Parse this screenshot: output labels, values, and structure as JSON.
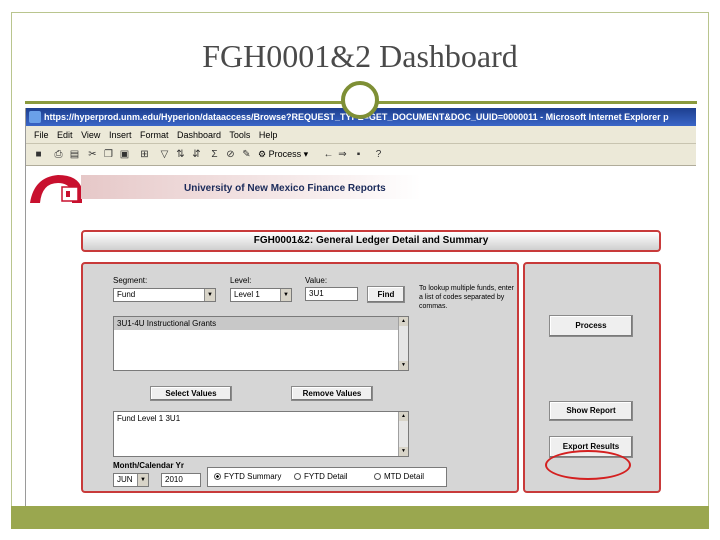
{
  "slide": {
    "title": "FGH0001&2 Dashboard"
  },
  "browser": {
    "title_bar": "https://hyperprod.unm.edu/Hyperion/dataaccess/Browse?REQUEST_TYPE=GET_DOCUMENT&DOC_UUID=0000011 - Microsoft Internet Explorer p",
    "menu": [
      "File",
      "Edit",
      "View",
      "Insert",
      "Format",
      "Dashboard",
      "Tools",
      "Help"
    ],
    "toolbar_process_label": "Process"
  },
  "page": {
    "banner": "University of New Mexico Finance Reports",
    "header": "FGH0001&2: General Ledger Detail and Summary",
    "segment": {
      "label": "Segment:",
      "value": "Fund"
    },
    "level": {
      "label": "Level:",
      "value": "Level 1"
    },
    "value_field": {
      "label": "Value:",
      "value": "3U1"
    },
    "find_button": "Find",
    "help_text": "To lookup multiple funds, enter a list of codes separated by commas.",
    "available_list": [
      "3U1-4U Instructional Grants"
    ],
    "select_values_button": "Select Values",
    "remove_values_button": "Remove Values",
    "selected_list": [
      "Fund Level 1 3U1"
    ],
    "period": {
      "label": "Month/Calendar Yr",
      "month": "JUN",
      "year": "2010"
    },
    "radios": [
      {
        "label": "FYTD Summary",
        "checked": true
      },
      {
        "label": "FYTD Detail",
        "checked": false
      },
      {
        "label": "MTD Detail",
        "checked": false
      }
    ],
    "process_button": "Process",
    "show_report_button": "Show Report",
    "export_results_button": "Export Results"
  },
  "colors": {
    "panel_border": "#c83a3a",
    "slide_accent": "#8a9a3e",
    "highlight": "#d42020"
  }
}
